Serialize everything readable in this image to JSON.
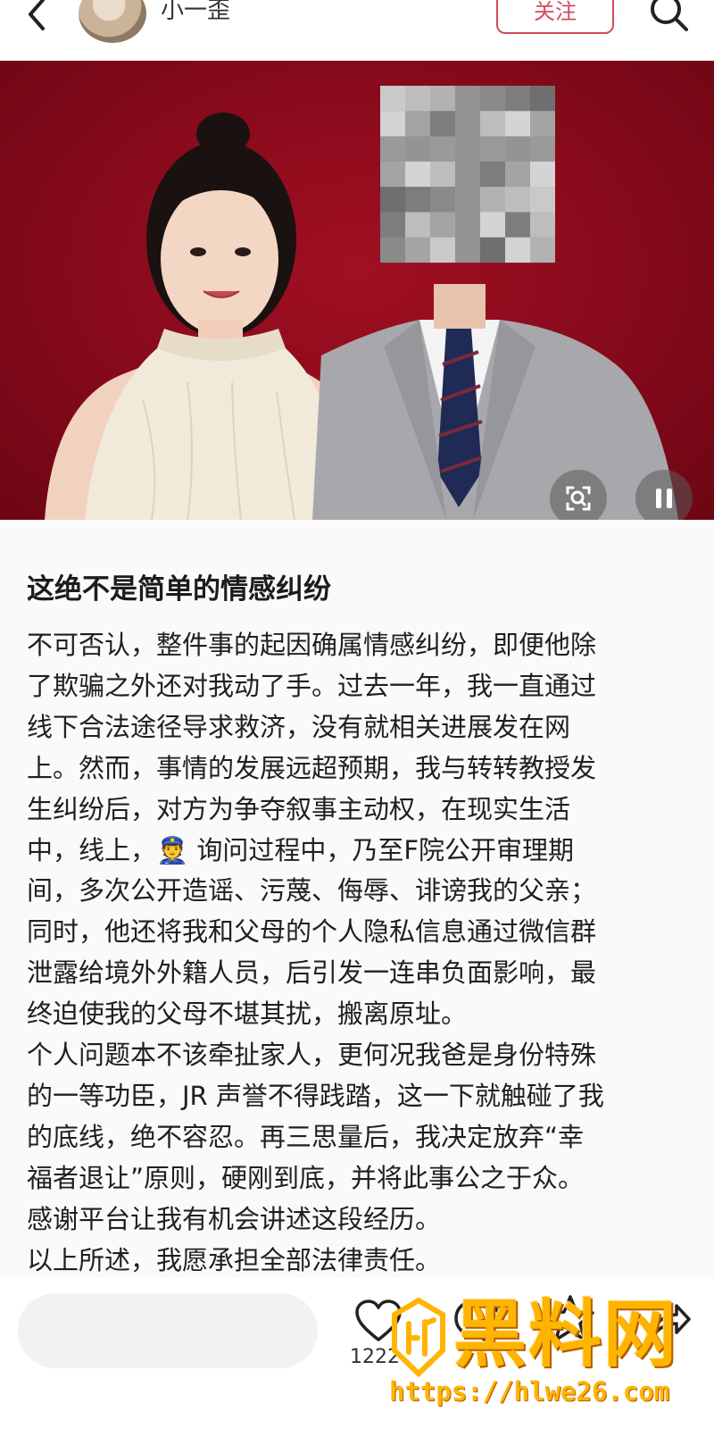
{
  "header": {
    "author_name": "小一歪",
    "follow_label": "关注",
    "icons": [
      "back-arrow-icon",
      "search-icon"
    ]
  },
  "photo": {
    "description_icons": [
      "lens-scan-icon",
      "pause-icon"
    ],
    "background_color": "#9b0e20"
  },
  "post": {
    "title": "这绝不是简单的情感纠纷",
    "lines": [
      "不可否认，整件事的起因确属情感纠纷，即便他除",
      "了欺骗之外还对我动了手。过去一年，我一直通过",
      "线下合法途径导求救济，没有就相关进展发在网",
      "上。然而，事情的发展远超预期，我与转转教授发",
      "生纠纷后，对方为争夺叙事主动权，在现实生活",
      "中，线上，👮 询问过程中，乃至F院公开审理期",
      "间，多次公开造谣、污蔑、侮辱、诽谤我的父亲；",
      "同时，他还将我和父母的个人隐私信息通过微信群",
      "泄露给境外外籍人员，后引发一连串负面影响，最",
      "终迫使我的父母不堪其扰，搬离原址。",
      "个人问题本不该牵扯家人，更何况我爸是身份特殊",
      "的一等功臣，JR 声誉不得践踏，这一下就触碰了我",
      "的底线，绝不容忍。再三思量后，我决定放弃“幸",
      "福者退让”原则，硬刚到底，并将此事公之于众。",
      "感谢平台让我有机会讲述这段经历。",
      "以上所述，我愿承担全部法律责任。"
    ]
  },
  "bottom_bar": {
    "comment_placeholder": "",
    "like_count": "1222",
    "icons": [
      "heart-icon",
      "comment-bubble-icon",
      "star-icon",
      "share-icon"
    ]
  },
  "watermark": {
    "brand": "黑料网",
    "url": "https://hlwe26.com",
    "color": "#ffb400"
  },
  "colors": {
    "accent": "#d34a5e",
    "photo_bg": "#9b0e20"
  }
}
